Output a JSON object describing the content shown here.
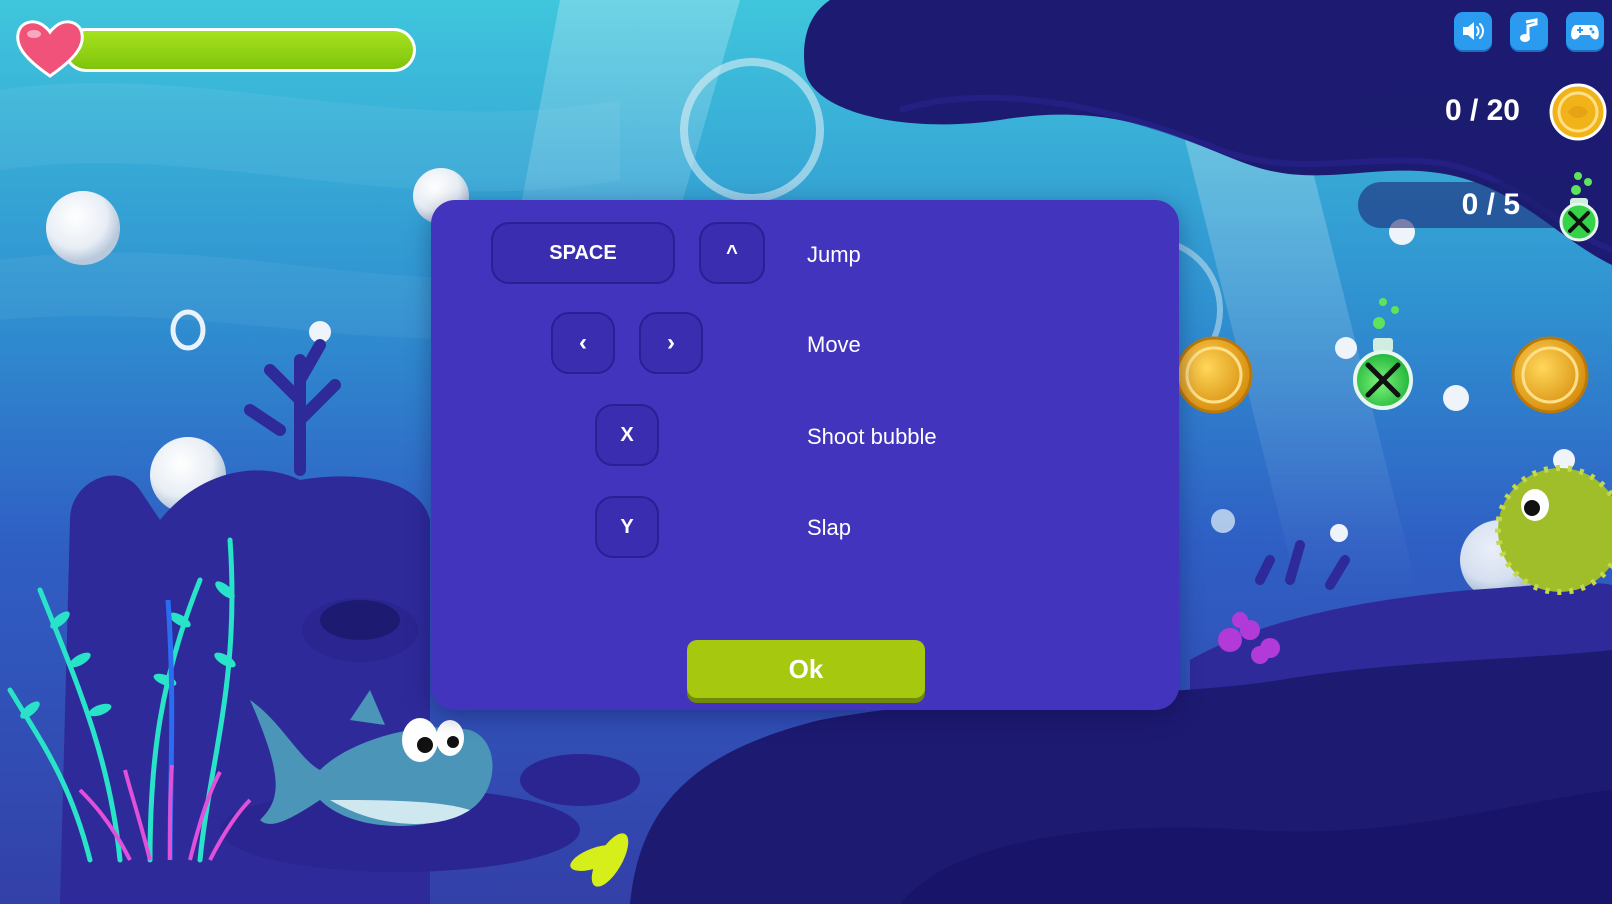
{
  "hud": {
    "health_fraction": 1.0,
    "coins": "0 / 20",
    "potions": "0 / 5",
    "icons": [
      "sound-icon",
      "music-icon",
      "gamepad-icon"
    ]
  },
  "controls": {
    "rows": [
      {
        "keys": [
          "SPACE",
          "^"
        ],
        "action": "Jump"
      },
      {
        "keys": [
          "‹",
          "›"
        ],
        "action": "Move"
      },
      {
        "keys": [
          "X"
        ],
        "action": "Shoot bubble"
      },
      {
        "keys": [
          "Y"
        ],
        "action": "Slap"
      }
    ],
    "ok_label": "Ok"
  },
  "colors": {
    "modal": "#4234bd",
    "ok_button": "#a6c80f",
    "health": "#8fd11a",
    "heart": "#f0527a",
    "coin": "#f2b319",
    "potion": "#34d34a"
  }
}
